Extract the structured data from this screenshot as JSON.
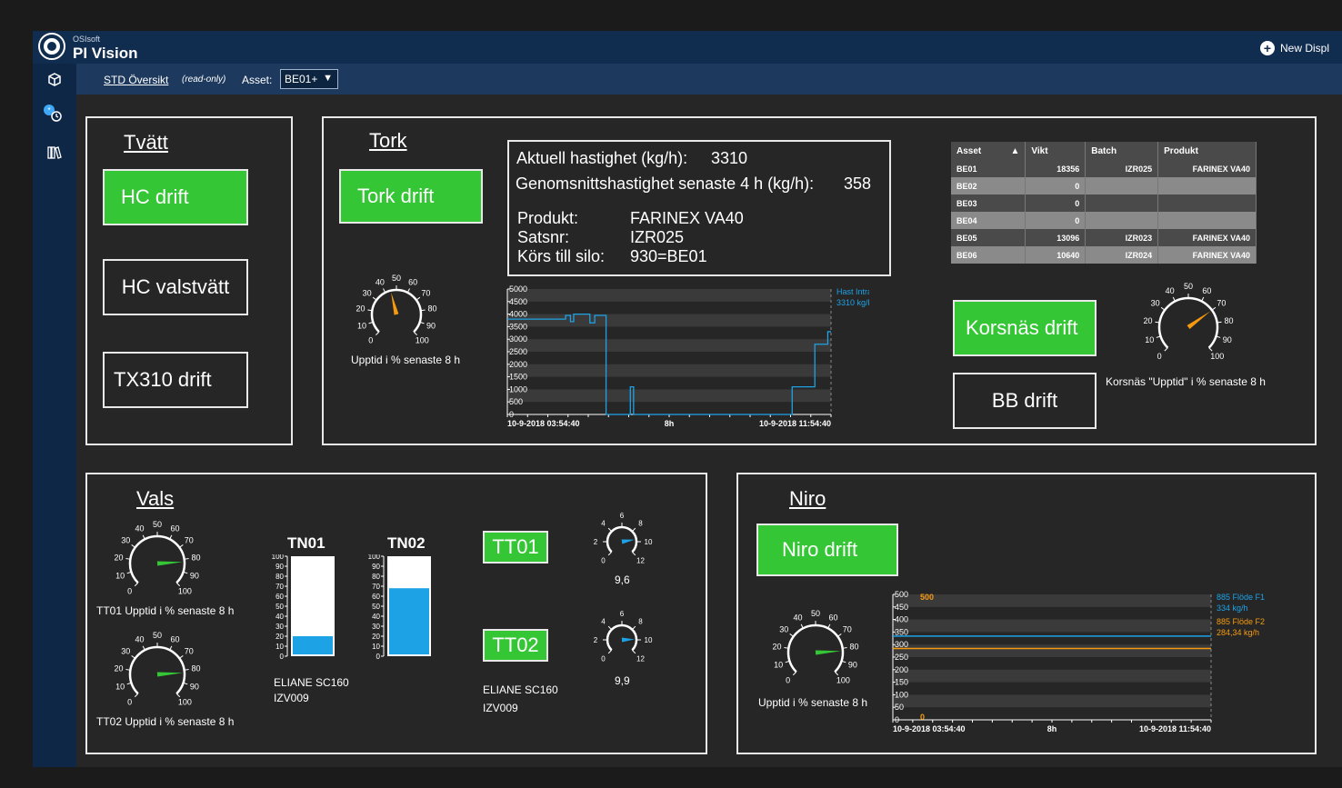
{
  "app": {
    "vendor": "OSIsoft",
    "name": "PI Vision",
    "new_display": "New Displ"
  },
  "sidebar": {
    "icons": [
      "cube-icon",
      "history-icon",
      "library-icon"
    ]
  },
  "subbar": {
    "breadcrumb": "STD Översikt",
    "read_only": "(read-only)",
    "asset_label": "Asset:",
    "asset_value": "BE01+"
  },
  "tvatt": {
    "title": "Tvätt",
    "hc_drift": "HC drift",
    "hc_valstvatt": "HC valstvätt",
    "tx310": "TX310 drift"
  },
  "tork": {
    "title": "Tork",
    "button": "Tork drift",
    "info": {
      "speed_label": "Aktuell hastighet (kg/h):",
      "speed_value": "3310",
      "avg_label": "Genomsnittshastighet senaste 4 h (kg/h):",
      "avg_value": "358",
      "produkt_label": "Produkt:",
      "produkt_value": "FARINEX VA40",
      "sats_label": "Satsnr:",
      "sats_value": "IZR025",
      "silo_label": "Körs till silo:",
      "silo_value": "930=BE01"
    },
    "gauge_label": "Upptid i % senaste 8 h",
    "gauge_value": 45,
    "trend": {
      "yticks": [
        "5000",
        "4500",
        "4000",
        "3500",
        "3000",
        "2500",
        "2000",
        "1500",
        "1000",
        "500",
        "0"
      ],
      "start": "10-9-2018 03:54:40",
      "mid": "8h",
      "end": "10-9-2018 11:54:40",
      "legend_name": "Hast Intransp",
      "legend_value": "3310 kg/h"
    }
  },
  "asset_table": {
    "headers": [
      "Asset",
      "Vikt",
      "Batch",
      "Produkt"
    ],
    "sort_icon": "▲",
    "rows": [
      [
        "BE01",
        "18356",
        "IZR025",
        "FARINEX VA40"
      ],
      [
        "BE02",
        "0",
        "",
        ""
      ],
      [
        "BE03",
        "0",
        "",
        ""
      ],
      [
        "BE04",
        "0",
        "",
        ""
      ],
      [
        "BE05",
        "13096",
        "IZR023",
        "FARINEX VA40"
      ],
      [
        "BE06",
        "10640",
        "IZR024",
        "FARINEX VA40"
      ]
    ]
  },
  "korsnas": {
    "button": "Korsnäs drift",
    "bb": "BB drift",
    "gauge_label": "Korsnäs \"Upptid\" i % senaste 8 h",
    "gauge_value": 70
  },
  "vals": {
    "title": "Vals",
    "tt01_gauge_label": "TT01 Upptid i % senaste 8 h",
    "tt01_gauge_value": 82,
    "tt02_gauge_label": "TT02 Upptid i % senaste 8 h",
    "tt02_gauge_value": 82,
    "tn01": {
      "title": "TN01",
      "level": 20
    },
    "tn02": {
      "title": "TN02",
      "level": 68
    },
    "tank_ticks": [
      "100",
      "90",
      "80",
      "70",
      "60",
      "50",
      "40",
      "30",
      "20",
      "10",
      "0"
    ],
    "tank_product": "ELIANE SC160",
    "tank_batch": "IZV009",
    "tt01": "TT01",
    "tt02": "TT02",
    "tt01_value": "9,6",
    "tt02_value": "9,9",
    "tt_product": "ELIANE SC160",
    "tt_batch": "IZV009"
  },
  "niro": {
    "title": "Niro",
    "button": "Niro drift",
    "gauge_label": "Upptid i % senaste 8 h",
    "gauge_value": 82,
    "trend": {
      "yticks": [
        "500",
        "450",
        "400",
        "350",
        "300",
        "250",
        "200",
        "150",
        "100",
        "50",
        "0"
      ],
      "y2_top": "500",
      "y2_bottom": "0",
      "start": "10-9-2018 03:54:40",
      "mid": "8h",
      "end": "10-9-2018 11:54:40",
      "series1_name": "885 Flöde F1",
      "series1_value": "334 kg/h",
      "series2_name": "885 Flöde F2",
      "series2_value": "284,34 kg/h"
    }
  },
  "colors": {
    "green": "#35c635",
    "blue": "#1ea2e6",
    "orange": "#f59a10",
    "header": "#102c4f"
  }
}
